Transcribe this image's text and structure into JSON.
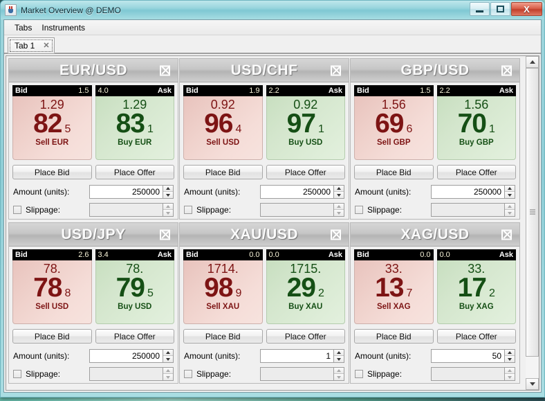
{
  "window": {
    "title": "Market Overview @ DEMO",
    "icon": "java-cup-icon",
    "minimize_label": "—",
    "maximize_label": "□",
    "close_label": "X"
  },
  "menubar": {
    "items": [
      {
        "label": "Tabs",
        "name": "menu-tabs"
      },
      {
        "label": "Instruments",
        "name": "menu-instruments"
      }
    ]
  },
  "tabs": [
    {
      "label": "Tab 1",
      "close_label": "✕",
      "selected": true
    }
  ],
  "labels": {
    "bid": "Bid",
    "ask": "Ask",
    "place_bid": "Place Bid",
    "place_offer": "Place Offer",
    "amount": "Amount (units):",
    "slippage": "Slippage:",
    "close_glyph": "☒"
  },
  "colors": {
    "bid_text": "#7d1414",
    "ask_text": "#154f15",
    "bid_bg": "#f2d6d1",
    "ask_bg": "#d8e9d1",
    "header_bg": "#000000",
    "spread_text": "#f7f3d8",
    "titlebar": "#9ad6de",
    "panel_title_text": "#fbfbfb"
  },
  "panels": [
    {
      "name": "eurusd",
      "title": "EUR/USD",
      "bid": {
        "spread": "1.5",
        "head": "1.29",
        "main": "82",
        "frac": "5",
        "action": "Sell EUR"
      },
      "ask": {
        "spread": "4.0",
        "head": "1.29",
        "main": "83",
        "frac": "1",
        "action": "Buy EUR"
      },
      "amount": "250000",
      "slippage": "",
      "slippage_checked": false
    },
    {
      "name": "usdchf",
      "title": "USD/CHF",
      "bid": {
        "spread": "1.9",
        "head": "0.92",
        "main": "96",
        "frac": "4",
        "action": "Sell USD"
      },
      "ask": {
        "spread": "2.2",
        "head": "0.92",
        "main": "97",
        "frac": "1",
        "action": "Buy USD"
      },
      "amount": "250000",
      "slippage": "",
      "slippage_checked": false
    },
    {
      "name": "gbpusd",
      "title": "GBP/USD",
      "bid": {
        "spread": "1.5",
        "head": "1.56",
        "main": "69",
        "frac": "6",
        "action": "Sell GBP"
      },
      "ask": {
        "spread": "2.2",
        "head": "1.56",
        "main": "70",
        "frac": "1",
        "action": "Buy GBP"
      },
      "amount": "250000",
      "slippage": "",
      "slippage_checked": false
    },
    {
      "name": "usdjpy",
      "title": "USD/JPY",
      "bid": {
        "spread": "2.6",
        "head": "78.",
        "main": "78",
        "frac": "8",
        "action": "Sell USD"
      },
      "ask": {
        "spread": "3.4",
        "head": "78.",
        "main": "79",
        "frac": "5",
        "action": "Buy USD"
      },
      "amount": "250000",
      "slippage": "",
      "slippage_checked": false
    },
    {
      "name": "xauusd",
      "title": "XAU/USD",
      "bid": {
        "spread": "0.0",
        "head": "1714.",
        "main": "98",
        "frac": "9",
        "action": "Sell XAU"
      },
      "ask": {
        "spread": "0.0",
        "head": "1715.",
        "main": "29",
        "frac": "2",
        "action": "Buy XAU"
      },
      "amount": "1",
      "slippage": "",
      "slippage_checked": false
    },
    {
      "name": "xagusd",
      "title": "XAG/USD",
      "bid": {
        "spread": "0.0",
        "head": "33.",
        "main": "13",
        "frac": "7",
        "action": "Sell XAG"
      },
      "ask": {
        "spread": "0.0",
        "head": "33.",
        "main": "17",
        "frac": "2",
        "action": "Buy XAG"
      },
      "amount": "50",
      "slippage": "",
      "slippage_checked": false
    }
  ]
}
